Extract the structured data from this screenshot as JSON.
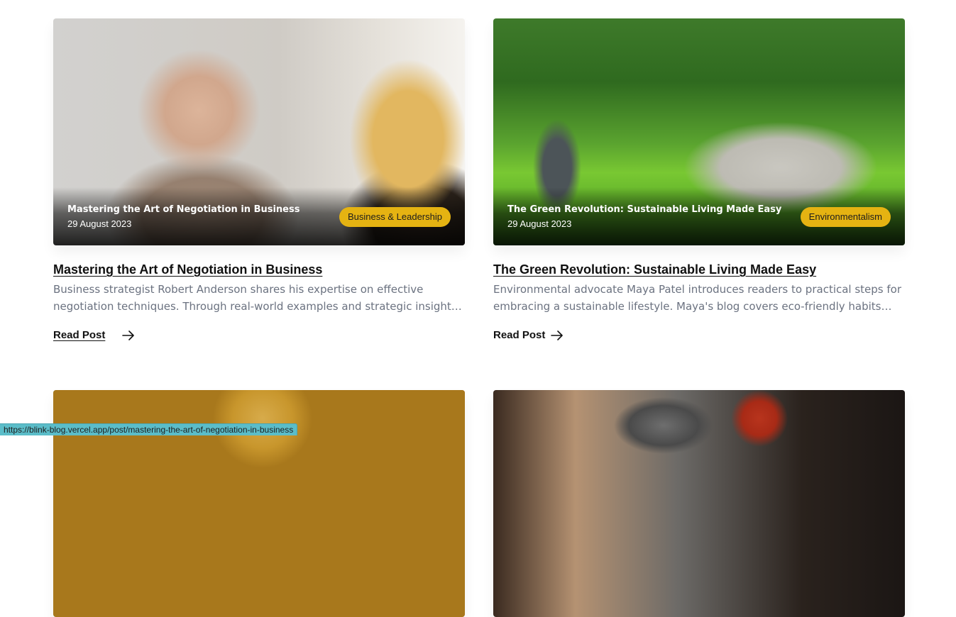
{
  "posts": [
    {
      "overlay_title": "Mastering the Art of Negotiation in Business",
      "date": "29 August 2023",
      "category": "Business & Leadership",
      "title": "Mastering the Art of Negotiation in Business",
      "excerpt": "Business strategist Robert Anderson shares his expertise on effective negotiation techniques. Through real-world examples and strategic insights, Robert empowe...",
      "read_label": "Read Post"
    },
    {
      "overlay_title": "The Green Revolution: Sustainable Living Made Easy",
      "date": "29 August 2023",
      "category": "Environmentalism",
      "title": "The Green Revolution: Sustainable Living Made Easy",
      "excerpt": "Environmental advocate Maya Patel introduces readers to practical steps for embracing a sustainable lifestyle. Maya's blog covers eco-friendly habits for...",
      "read_label": "Read Post"
    }
  ],
  "colors": {
    "badge": "#e5b312",
    "status_bar": "#5bbdc9"
  },
  "status_bar": {
    "url": "https://blink-blog.vercel.app/post/mastering-the-art-of-negotiation-in-business"
  }
}
